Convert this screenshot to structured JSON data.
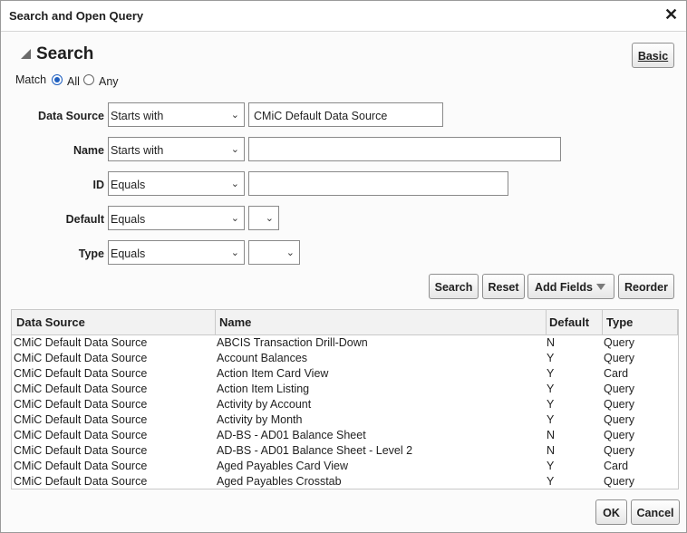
{
  "dialog": {
    "title": "Search and Open Query"
  },
  "search": {
    "heading": "Search",
    "basic_button": "Basic",
    "match_label": "Match",
    "match_options": [
      "All",
      "Any"
    ],
    "match_selected": "All",
    "fields": {
      "data_source": {
        "label": "Data Source",
        "operator": "Starts with",
        "value": "CMiC Default Data Source"
      },
      "name": {
        "label": "Name",
        "operator": "Starts with",
        "value": ""
      },
      "id": {
        "label": "ID",
        "operator": "Equals",
        "value": ""
      },
      "default": {
        "label": "Default",
        "operator": "Equals",
        "value": ""
      },
      "type": {
        "label": "Type",
        "operator": "Equals",
        "value": ""
      }
    },
    "buttons": {
      "search": "Search",
      "reset": "Reset",
      "add_fields": "Add Fields",
      "reorder": "Reorder"
    }
  },
  "results": {
    "columns": [
      "Data Source",
      "Name",
      "Default",
      "Type"
    ],
    "rows": [
      [
        "CMiC Default Data Source",
        "ABCIS Transaction Drill-Down",
        "N",
        "Query"
      ],
      [
        "CMiC Default Data Source",
        "Account Balances",
        "Y",
        "Query"
      ],
      [
        "CMiC Default Data Source",
        "Action Item Card View",
        "Y",
        "Card"
      ],
      [
        "CMiC Default Data Source",
        "Action Item Listing",
        "Y",
        "Query"
      ],
      [
        "CMiC Default Data Source",
        "Activity by Account",
        "Y",
        "Query"
      ],
      [
        "CMiC Default Data Source",
        "Activity by Month",
        "Y",
        "Query"
      ],
      [
        "CMiC Default Data Source",
        "AD-BS - AD01 Balance Sheet",
        "N",
        "Query"
      ],
      [
        "CMiC Default Data Source",
        "AD-BS - AD01 Balance Sheet - Level 2",
        "N",
        "Query"
      ],
      [
        "CMiC Default Data Source",
        "Aged Payables Card View",
        "Y",
        "Card"
      ],
      [
        "CMiC Default Data Source",
        "Aged Payables Crosstab",
        "Y",
        "Query"
      ]
    ]
  },
  "footer": {
    "ok": "OK",
    "cancel": "Cancel"
  }
}
